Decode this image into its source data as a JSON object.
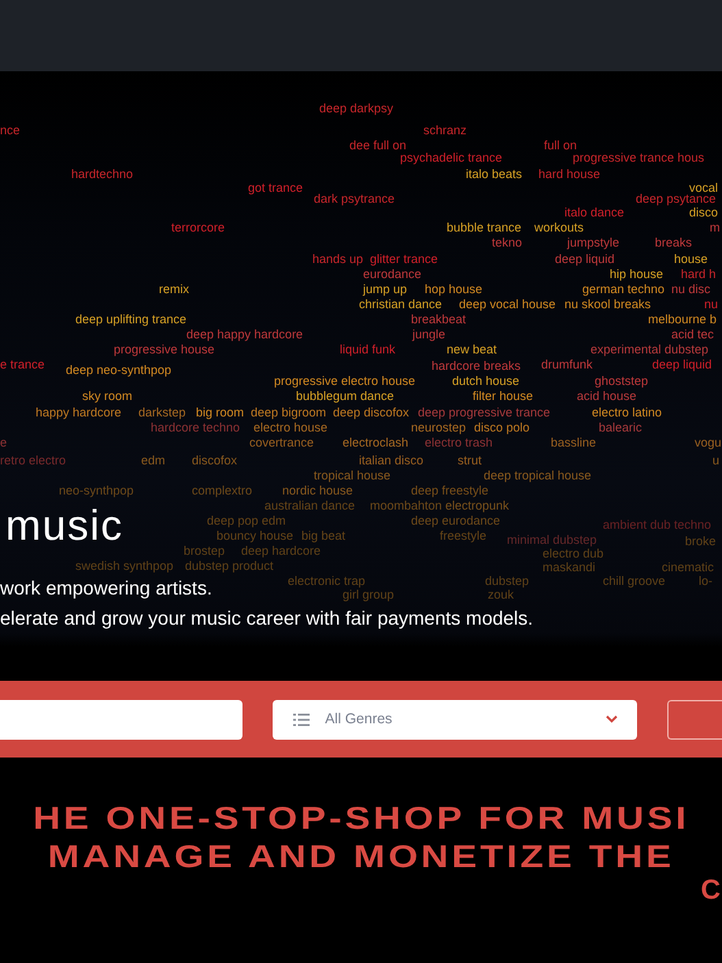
{
  "genre_cloud": [
    {
      "text": "deep darkpsy",
      "color": "#c8262b"
    },
    {
      "text": "nce",
      "color": "#c8262b"
    },
    {
      "text": "schranz",
      "color": "#c8262b"
    },
    {
      "text": "dee full on",
      "color": "#c8262b"
    },
    {
      "text": "full on",
      "color": "#c8262b"
    },
    {
      "text": "psychadelic trance",
      "color": "#d1202a"
    },
    {
      "text": "progressive trance hous",
      "color": "#c8262b"
    },
    {
      "text": "hardtechno",
      "color": "#c8262b"
    },
    {
      "text": "italo beats",
      "color": "#d7a125"
    },
    {
      "text": "hard house",
      "color": "#c8262b"
    },
    {
      "text": "got trance",
      "color": "#d1202a"
    },
    {
      "text": "vocal",
      "color": "#d7a125"
    },
    {
      "text": "dark psytrance",
      "color": "#c8262b"
    },
    {
      "text": "deep psytance",
      "color": "#c8262b"
    },
    {
      "text": "italo dance",
      "color": "#d1202a"
    },
    {
      "text": "disco",
      "color": "#d7a125"
    },
    {
      "text": "terrorcore",
      "color": "#d1202a"
    },
    {
      "text": "bubble trance",
      "color": "#d7a125"
    },
    {
      "text": "workouts",
      "color": "#d7a125"
    },
    {
      "text": "m",
      "color": "#c0393b"
    },
    {
      "text": "tekno",
      "color": "#c0393b"
    },
    {
      "text": "jumpstyle",
      "color": "#c0393b"
    },
    {
      "text": "breaks",
      "color": "#c0393b"
    },
    {
      "text": "hands up",
      "color": "#c8262b"
    },
    {
      "text": "glitter trance",
      "color": "#d1202a"
    },
    {
      "text": "deep liquid",
      "color": "#c0393b"
    },
    {
      "text": "house",
      "color": "#d7a125"
    },
    {
      "text": "eurodance",
      "color": "#c0393b"
    },
    {
      "text": "hip house",
      "color": "#d7a125"
    },
    {
      "text": "hard h",
      "color": "#c8262b"
    },
    {
      "text": "remix",
      "color": "#d7a125"
    },
    {
      "text": "jump up",
      "color": "#d7a125"
    },
    {
      "text": "hop house",
      "color": "#d38a22"
    },
    {
      "text": "german techno",
      "color": "#d38a22"
    },
    {
      "text": "nu disc",
      "color": "#c0393b"
    },
    {
      "text": "christian dance",
      "color": "#d7a125"
    },
    {
      "text": "deep vocal house",
      "color": "#d38a22"
    },
    {
      "text": "nu skool breaks",
      "color": "#d38a22"
    },
    {
      "text": "nu",
      "color": "#d1202a"
    },
    {
      "text": "deep uplifting trance",
      "color": "#d7a125"
    },
    {
      "text": "breakbeat",
      "color": "#c0393b"
    },
    {
      "text": "melbourne b",
      "color": "#d38a22"
    },
    {
      "text": "deep happy hardcore",
      "color": "#c0393b"
    },
    {
      "text": "jungle",
      "color": "#c0393b"
    },
    {
      "text": "acid tec",
      "color": "#c0393b"
    },
    {
      "text": "progressive house",
      "color": "#c0393b"
    },
    {
      "text": "liquid funk",
      "color": "#d1202a"
    },
    {
      "text": "new beat",
      "color": "#d7a125"
    },
    {
      "text": "experimental dubstep",
      "color": "#b83a3c"
    },
    {
      "text": "e trance",
      "color": "#d1202a"
    },
    {
      "text": "deep neo-synthpop",
      "color": "#d38a22"
    },
    {
      "text": "hardcore breaks",
      "color": "#c0393b"
    },
    {
      "text": "drumfunk",
      "color": "#c0393b"
    },
    {
      "text": "deep liquid",
      "color": "#d1202a"
    },
    {
      "text": "progressive electro house",
      "color": "#d38a22"
    },
    {
      "text": "dutch house",
      "color": "#d7a125"
    },
    {
      "text": "ghoststep",
      "color": "#c0393b"
    },
    {
      "text": "sky room",
      "color": "#d38a22"
    },
    {
      "text": "bubblegum dance",
      "color": "#d7a125"
    },
    {
      "text": "filter house",
      "color": "#d38a22"
    },
    {
      "text": "acid house",
      "color": "#b83a3c"
    },
    {
      "text": "happy hardcore",
      "color": "#c07a22"
    },
    {
      "text": "darkstep",
      "color": "#a86a22"
    },
    {
      "text": "big room",
      "color": "#d38a22"
    },
    {
      "text": "deep bigroom",
      "color": "#c07a22"
    },
    {
      "text": "deep discofox",
      "color": "#c07a22"
    },
    {
      "text": "deep progressive trance",
      "color": "#a83a3c"
    },
    {
      "text": "electro latino",
      "color": "#d38a22"
    },
    {
      "text": "hardcore techno",
      "color": "#8e3234"
    },
    {
      "text": "electro house",
      "color": "#a86a22"
    },
    {
      "text": "neurostep",
      "color": "#a86a22"
    },
    {
      "text": "disco polo",
      "color": "#c07a22"
    },
    {
      "text": "balearic",
      "color": "#a83a3c"
    },
    {
      "text": "e",
      "color": "#8e3234"
    },
    {
      "text": "covertrance",
      "color": "#9a6020"
    },
    {
      "text": "electroclash",
      "color": "#a86a22"
    },
    {
      "text": "electro trash",
      "color": "#8e3234"
    },
    {
      "text": "bassline",
      "color": "#9a6020"
    },
    {
      "text": "vogu",
      "color": "#9a6020"
    },
    {
      "text": "retro electro",
      "color": "#7a2a2c"
    },
    {
      "text": "edm",
      "color": "#8a5a1e"
    },
    {
      "text": "discofox",
      "color": "#8a5a1e"
    },
    {
      "text": "italian disco",
      "color": "#9a6020"
    },
    {
      "text": "strut",
      "color": "#9a6020"
    },
    {
      "text": "u",
      "color": "#8a5a1e"
    },
    {
      "text": "tropical house",
      "color": "#8a5a1e"
    },
    {
      "text": "deep tropical house",
      "color": "#8a5a1e"
    },
    {
      "text": "neo-synthpop",
      "color": "#6e4a1a"
    },
    {
      "text": "complextro",
      "color": "#6e4a1a"
    },
    {
      "text": "nordic house",
      "color": "#8a5a1e"
    },
    {
      "text": "deep freestyle",
      "color": "#7a501a"
    },
    {
      "text": "australian dance",
      "color": "#664518"
    },
    {
      "text": "moombahton",
      "color": "#6e4a1a"
    },
    {
      "text": "electropunk",
      "color": "#7a521c"
    },
    {
      "text": "deep pop edm",
      "color": "#664518"
    },
    {
      "text": "deep eurodance",
      "color": "#6e4a1a"
    },
    {
      "text": "ambient dub techno",
      "color": "#6a2224"
    },
    {
      "text": "bouncy house",
      "color": "#664518"
    },
    {
      "text": "big beat",
      "color": "#664518"
    },
    {
      "text": "freestyle",
      "color": "#664518"
    },
    {
      "text": "minimal dubstep",
      "color": "#66282a"
    },
    {
      "text": "broke",
      "color": "#604218"
    },
    {
      "text": "brostep",
      "color": "#604218"
    },
    {
      "text": "deep hardcore",
      "color": "#604218"
    },
    {
      "text": "electro dub",
      "color": "#604218"
    },
    {
      "text": "swedish synthpop",
      "color": "#604218"
    },
    {
      "text": "dubstep product",
      "color": "#604218"
    },
    {
      "text": "maskandi",
      "color": "#604218"
    },
    {
      "text": "cinematic",
      "color": "#604218"
    },
    {
      "text": "electronic trap",
      "color": "#604218"
    },
    {
      "text": "dubstep",
      "color": "#604218"
    },
    {
      "text": "chill groove",
      "color": "#604218"
    },
    {
      "text": "lo-",
      "color": "#604218"
    },
    {
      "text": "girl group",
      "color": "#604218"
    },
    {
      "text": "zouk",
      "color": "#604218"
    }
  ],
  "hero": {
    "logo_text": "music",
    "tagline_lines": [
      "work empowering artists.",
      "elerate and grow your music career with fair payments models."
    ]
  },
  "search_bar": {
    "genre_select": {
      "value": "All Genres"
    }
  },
  "headline_lines": [
    "HE ONE-STOP-SHOP FOR MUSI",
    "MANAGE AND MONETIZE THE"
  ],
  "headline_tail": "C"
}
